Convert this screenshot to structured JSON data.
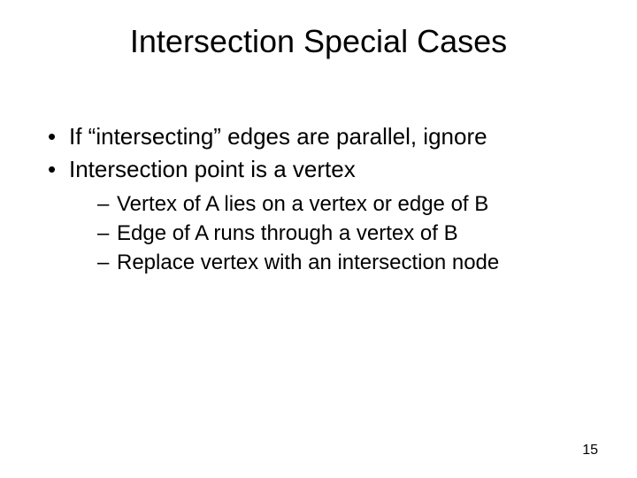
{
  "title": "Intersection Special Cases",
  "bullets": [
    "If “intersecting” edges are parallel, ignore",
    "Intersection point is a vertex"
  ],
  "sub_bullets": [
    "Vertex of A lies on a vertex or edge of B",
    "Edge of A runs through a vertex of B",
    "Replace vertex with an intersection node"
  ],
  "page_number": "15"
}
